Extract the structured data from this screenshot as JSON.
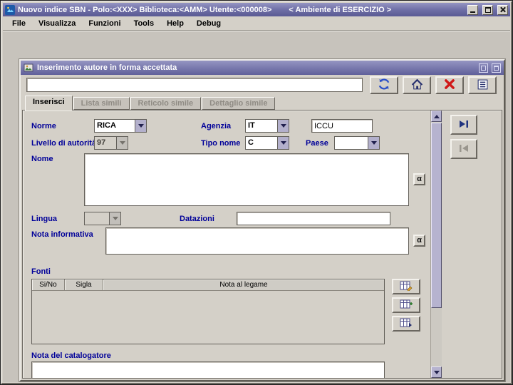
{
  "window": {
    "title": "Nuovo indice SBN - Polo:<XXX> Biblioteca:<AMM> Utente:<000008>",
    "environment": "< Ambiente di ESERCIZIO >"
  },
  "menubar": {
    "items": [
      "File",
      "Visualizza",
      "Funzioni",
      "Tools",
      "Help",
      "Debug"
    ]
  },
  "frame": {
    "title": "Inserimento autore in forma accettata",
    "toolbar": {
      "query_value": ""
    },
    "tabs": [
      {
        "label": "Inserisci",
        "state": "active"
      },
      {
        "label": "Lista simili",
        "state": "disabled"
      },
      {
        "label": "Reticolo simile",
        "state": "disabled"
      },
      {
        "label": "Dettaglio simile",
        "state": "disabled"
      }
    ],
    "form": {
      "norme_label": "Norme",
      "norme_value": "RICA",
      "agenzia_label": "Agenzia",
      "agenzia_value": "IT",
      "agenzia_code": "ICCU",
      "livello_label": "Livello di autorità",
      "livello_value": "97",
      "tipo_nome_label": "Tipo nome",
      "tipo_nome_value": "C",
      "paese_label": "Paese",
      "paese_value": "",
      "nome_label": "Nome",
      "nome_value": "",
      "lingua_label": "Lingua",
      "lingua_value": "",
      "datazioni_label": "Datazioni",
      "datazioni_value": "",
      "nota_informativa_label": "Nota informativa",
      "nota_informativa_value": "",
      "special_char": "α",
      "fonti_label": "Fonti",
      "fonti_columns": [
        "Si/No",
        "Sigla",
        "Nota al legame"
      ],
      "nota_catalogatore_label": "Nota del catalogatore",
      "nota_catalogatore_value": ""
    }
  },
  "icons": {
    "window_controls": [
      "minimize-icon",
      "maximize-icon",
      "close-icon"
    ],
    "frame_corner": [
      "restore-icon",
      "maximize-icon"
    ],
    "toolbar": [
      "refresh-icon",
      "home-icon",
      "cancel-icon",
      "list-icon"
    ],
    "table_buttons": [
      "edit-table-icon",
      "insert-table-icon",
      "link-table-icon"
    ],
    "side_buttons": [
      "forward-icon",
      "back-icon"
    ],
    "scrollbar": [
      "arrow-up-icon",
      "arrow-down-icon"
    ]
  }
}
